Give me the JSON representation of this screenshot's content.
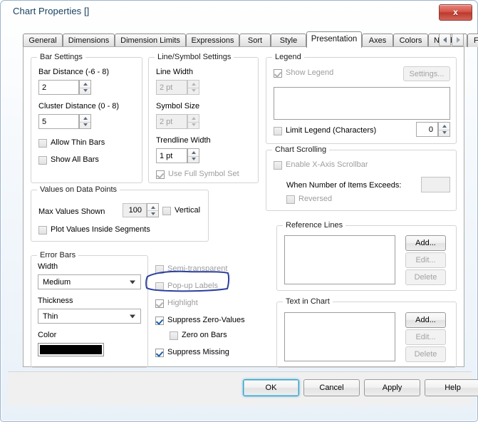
{
  "window": {
    "title": "Chart Properties []",
    "close_label": "x"
  },
  "tabs": [
    {
      "label": "General",
      "selected": false
    },
    {
      "label": "Dimensions",
      "selected": false
    },
    {
      "label": "Dimension Limits",
      "selected": false
    },
    {
      "label": "Expressions",
      "selected": false
    },
    {
      "label": "Sort",
      "selected": false
    },
    {
      "label": "Style",
      "selected": false
    },
    {
      "label": "Presentation",
      "selected": true
    },
    {
      "label": "Axes",
      "selected": false
    },
    {
      "label": "Colors",
      "selected": false
    },
    {
      "label": "Number",
      "selected": false
    },
    {
      "label": "Font",
      "selected": false
    }
  ],
  "bar_settings": {
    "caption": "Bar Settings",
    "bar_distance_label": "Bar Distance (-6 - 8)",
    "bar_distance_value": "2",
    "cluster_distance_label": "Cluster Distance (0 - 8)",
    "cluster_distance_value": "5",
    "allow_thin_bars": "Allow Thin Bars",
    "show_all_bars": "Show All Bars"
  },
  "line_symbol_settings": {
    "caption": "Line/Symbol Settings",
    "line_width_label": "Line Width",
    "line_width_value": "2 pt",
    "symbol_size_label": "Symbol Size",
    "symbol_size_value": "2 pt",
    "trendline_width_label": "Trendline Width",
    "trendline_width_value": "1 pt",
    "use_full_symbol_set": "Use Full Symbol Set"
  },
  "values_on_data_points": {
    "caption": "Values on Data Points",
    "max_values_shown_label": "Max Values Shown",
    "max_values_shown_value": "100",
    "vertical": "Vertical",
    "plot_values_inside_segments": "Plot Values Inside Segments"
  },
  "error_bars": {
    "caption": "Error Bars",
    "width_label": "Width",
    "width_value": "Medium",
    "thickness_label": "Thickness",
    "thickness_value": "Thin",
    "color_label": "Color",
    "color_value": "#000000"
  },
  "middle_options": [
    {
      "label": "Semi-transparent",
      "checked": false,
      "enabled": false
    },
    {
      "label": "Pop-up Labels",
      "checked": false,
      "enabled": false
    },
    {
      "label": "Highlight",
      "checked": true,
      "enabled": false
    },
    {
      "label": "Suppress Zero-Values",
      "checked": true,
      "enabled": true
    },
    {
      "label": "Zero on Bars",
      "checked": false,
      "enabled": false
    },
    {
      "label": "Suppress Missing",
      "checked": true,
      "enabled": true
    }
  ],
  "legend": {
    "caption": "Legend",
    "show_legend": "Show Legend",
    "show_legend_checked": true,
    "settings_button": "Settings...",
    "list_items": [],
    "limit_legend": "Limit Legend (Characters)",
    "limit_legend_checked": false,
    "limit_legend_value": "0"
  },
  "chart_scrolling": {
    "caption": "Chart Scrolling",
    "enable_x_axis_scrollbar": "Enable X-Axis Scrollbar",
    "enable_x_axis_scrollbar_checked": false,
    "when_number_of_items_exceeds": "When Number of Items Exceeds:",
    "when_number_of_items_exceeds_value": "",
    "reversed": "Reversed",
    "reversed_checked": false
  },
  "reference_lines": {
    "caption": "Reference Lines",
    "list_items": [],
    "add_button": "Add...",
    "edit_button": "Edit...",
    "delete_button": "Delete"
  },
  "text_in_chart": {
    "caption": "Text in Chart",
    "list_items": [],
    "add_button": "Add...",
    "edit_button": "Edit...",
    "delete_button": "Delete"
  },
  "buttons": {
    "ok": "OK",
    "cancel": "Cancel",
    "apply": "Apply",
    "help": "Help"
  },
  "annotation": {
    "target": "Pop-up Labels",
    "shape": "hand-drawn-rounded-rectangle",
    "color": "#2b3f9e"
  }
}
